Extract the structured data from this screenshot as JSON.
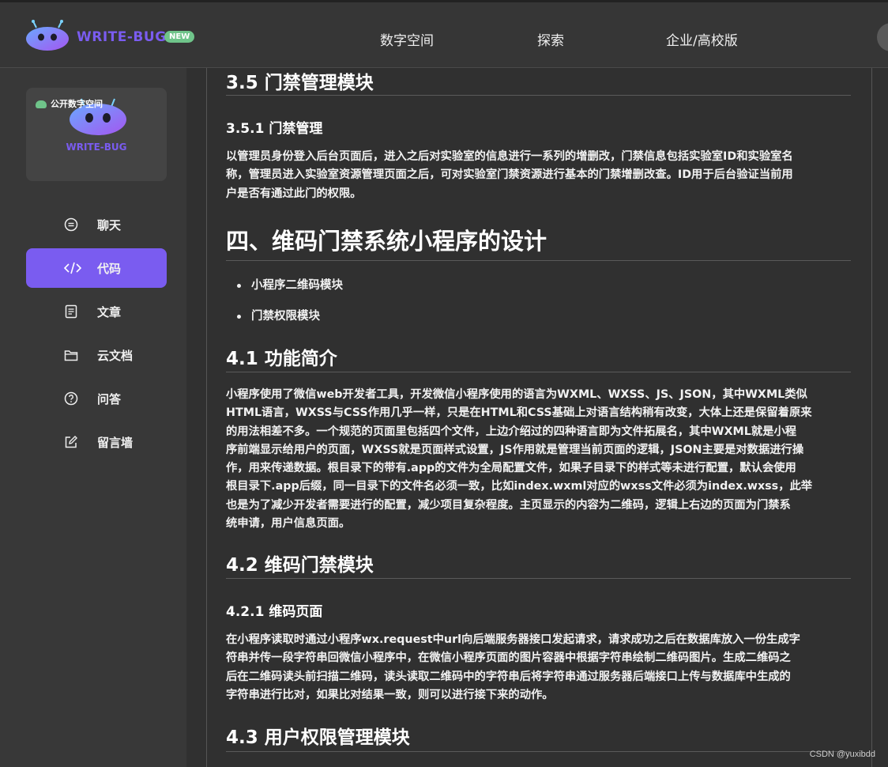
{
  "header": {
    "brand": "WRITE-BUG",
    "badge": "NEW",
    "nav": [
      "数字空间",
      "探索",
      "企业/高校版"
    ]
  },
  "sidebar": {
    "card_tag": "公开数字空间",
    "card_brand": "WRITE-BUG",
    "items": [
      {
        "label": "聊天",
        "icon": "chat-icon"
      },
      {
        "label": "代码",
        "icon": "code-icon",
        "active": true
      },
      {
        "label": "文章",
        "icon": "article-icon"
      },
      {
        "label": "云文档",
        "icon": "folder-icon"
      },
      {
        "label": "问答",
        "icon": "question-icon"
      },
      {
        "label": "留言墙",
        "icon": "edit-icon"
      }
    ]
  },
  "article": {
    "s35_title": "3.5 门禁管理模块",
    "s351_title": "3.5.1 门禁管理",
    "s351_lines": [
      " 以管理员身份登入后台页面后，进入之后对实验室的信息进行一系列的增删改，门禁信息包括实验室ID和实验室名",
      "称，管理员进入实验室资源管理页面之后，可对实验室门禁资源进行基本的门禁增删改查。ID用于后台验证当前用",
      "户是否有通过此门的权限。"
    ],
    "s4_title": "四、维码门禁系统小程序的设计",
    "bullets": [
      "小程序二维码模块",
      "门禁权限模块"
    ],
    "s41_title": "4.1 功能简介",
    "s41_lines": [
      " 小程序使用了微信web开发者工具，开发微信小程序使用的语言为WXML、WXSS、JS、JSON，其中WXML类似",
      "HTML语言，WXSS与CSS作用几乎一样，只是在HTML和CSS基础上对语言结构稍有改变，大体上还是保留着原来",
      "的用法相差不多。一个规范的页面里包括四个文件，上边介绍过的四种语言即为文件拓展名，其中WXML就是小程",
      "序前端显示给用户的页面，WXSS就是页面样式设置，JS作用就是管理当前页面的逻辑，JSON主要是对数据进行操",
      "作，用来传递数据。根目录下的带有.app的文件为全局配置文件，如果子目录下的样式等未进行配置，默认会使用",
      "根目录下.app后缀，同一目录下的文件名必须一致，比如index.wxml对应的wxss文件必须为index.wxss，此举",
      "也是为了减少开发者需要进行的配置，减少项目复杂程度。主页显示的内容为二维码，逻辑上右边的页面为门禁系",
      "统申请，用户信息页面。"
    ],
    "s42_title": "4.2 维码门禁模块",
    "s421_title": "4.2.1 维码页面",
    "s421_lines": [
      " 在小程序读取时通过小程序wx.request中url向后端服务器接口发起请求，请求成功之后在数据库放入一份生成字",
      "符串并传一段字符串回微信小程序中，在微信小程序页面的图片容器中根据字符串绘制二维码图片。生成二维码之",
      "后在二维码读头前扫描二维码，读头读取二维码中的字符串后将字符串通过服务器后端接口上传与数据库中生成的",
      "字符串进行比对，如果比对结果一致，则可以进行接下来的动作。"
    ],
    "s43_title": "4.3 用户权限管理模块"
  },
  "watermark": "CSDN @yuxibdd"
}
